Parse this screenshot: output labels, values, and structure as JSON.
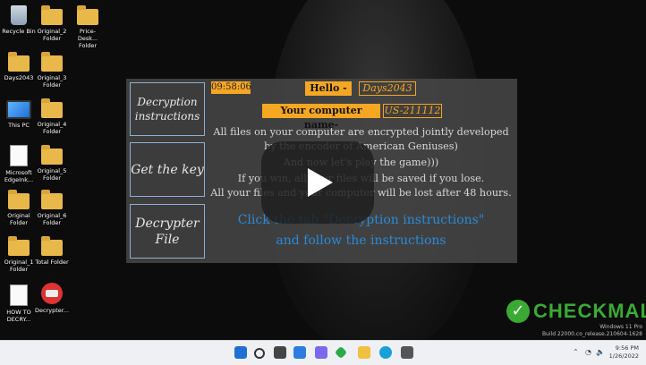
{
  "desktop": {
    "icons": [
      {
        "label": "Recycle Bin"
      },
      {
        "label": "Original_2 Folder"
      },
      {
        "label": "Price-Desk... Folder"
      },
      {
        "label": "Days2043"
      },
      {
        "label": "Original_3 Folder"
      },
      {
        "label": "This PC"
      },
      {
        "label": "Original_4 Folder"
      },
      {
        "label": "Microsoft EdgeInk..."
      },
      {
        "label": "Original_5 Folder"
      },
      {
        "label": "Original Folder"
      },
      {
        "label": "Original_6 Folder"
      },
      {
        "label": "Original_1 Folder"
      },
      {
        "label": "Total Folder"
      },
      {
        "label": "HOW TO DECRY..."
      },
      {
        "label": "Decrypter..."
      }
    ]
  },
  "ransom": {
    "tabs": [
      "Decryption instructions",
      "Get the key",
      "Decrypter File"
    ],
    "timer": "09:58:06",
    "hello_label": "Hello -",
    "hello_value": "Days2043",
    "computer_label": "Your computer name-",
    "computer_value": "US-211112",
    "message_lines": [
      "All files on your computer are encrypted jointly developed",
      "by the encoder of American Geniuses)",
      "And now let's play the game)))",
      "If you win, all your files will be saved if you lose.",
      "All your files and your computer will be lost after 48 hours."
    ],
    "cta_lines": [
      "Click the tab \"Decryption instructions\"",
      "and follow the instructions"
    ]
  },
  "watermark": {
    "brand": "CHECKMAL",
    "os_line1": "Windows 11 Pro",
    "os_line2": "Build 22000.co_release.210604-1628"
  },
  "taskbar": {
    "time": "9:56 PM",
    "date": "1/26/2022",
    "icons": [
      "start-icon",
      "search-icon",
      "task-view-icon",
      "widgets-icon",
      "chat-icon",
      "app-icon",
      "file-explorer-icon",
      "edge-icon",
      "store-icon"
    ]
  },
  "colors": {
    "accent": "#f5a623",
    "link": "#2a8bd8",
    "brand": "#3aaa35"
  }
}
